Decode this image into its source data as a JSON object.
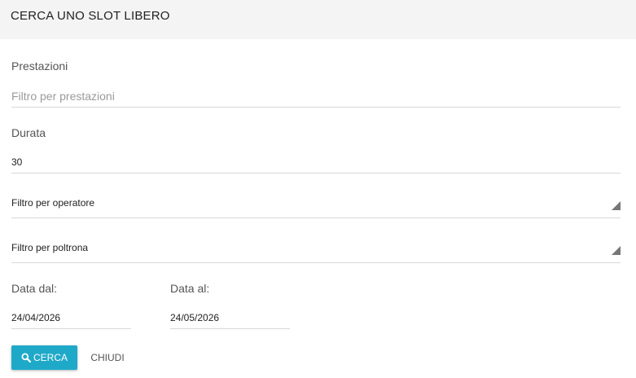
{
  "dialog": {
    "title": "CERCA UNO SLOT LIBERO"
  },
  "form": {
    "prestazioni": {
      "label": "Prestazioni",
      "value": "",
      "placeholder": "Filtro per prestazioni"
    },
    "durata": {
      "label": "Durata",
      "value": "30"
    },
    "operatore": {
      "selected": "Filtro per operatore"
    },
    "poltrona": {
      "selected": "Filtro per poltrona"
    },
    "data_dal": {
      "label": "Data dal:",
      "value": "24/04/2026"
    },
    "data_al": {
      "label": "Data al:",
      "value": "24/05/2026"
    }
  },
  "actions": {
    "search_label": "CERCA",
    "search_icon": "search-icon",
    "close_label": "CHIUDI"
  },
  "colors": {
    "accent": "#1fa9c9",
    "header_bg": "#f4f4f4"
  }
}
